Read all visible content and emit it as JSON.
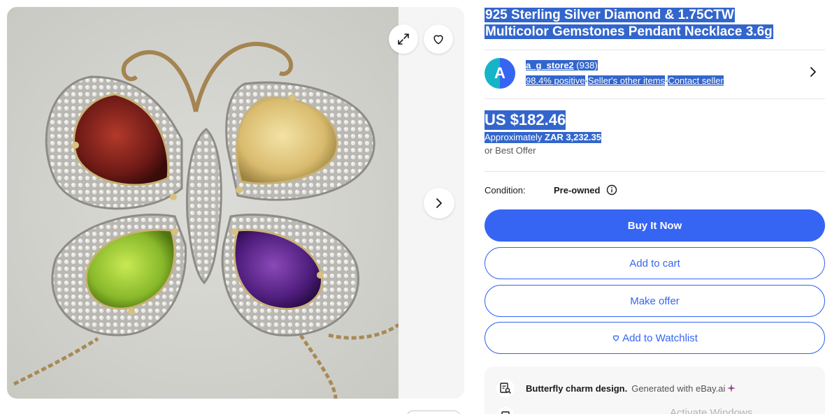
{
  "gallery": {
    "image_alt": "Butterfly pendant with garnet, citrine, peridot and amethyst stones",
    "expand_icon": "expand-icon",
    "favorite_icon": "heart-icon",
    "next_icon": "chevron-right-icon"
  },
  "listing": {
    "title_line1": "925 Sterling Silver Diamond & 1.75CTW",
    "title_line2": "Multicolor Gemstones Pendant Necklace 3.6g"
  },
  "seller": {
    "avatar_letter": "A",
    "name": "a_g_store2",
    "feedback_count": "(938)",
    "positive": "98.4% positive",
    "other_items": "Seller's other items",
    "contact": "Contact seller",
    "separator": "·"
  },
  "price": {
    "main": "US $182.46",
    "approx_label": "Approximately",
    "approx_value": "ZAR 3,232.35",
    "best_offer": "or Best Offer"
  },
  "condition": {
    "label": "Condition:",
    "value": "Pre-owned"
  },
  "actions": {
    "buy_now": "Buy It Now",
    "add_to_cart": "Add to cart",
    "make_offer": "Make offer",
    "watchlist": "Add to Watchlist"
  },
  "ai_summary": {
    "text": "Butterfly charm design.",
    "generated": "Generated with eBay.ai"
  },
  "os": {
    "watermark": "Activate Windows"
  },
  "colors": {
    "accent": "#3665f3",
    "selection": "#3366cc",
    "avatar_left": "#15b5c7",
    "avatar_right": "#3665f3"
  }
}
